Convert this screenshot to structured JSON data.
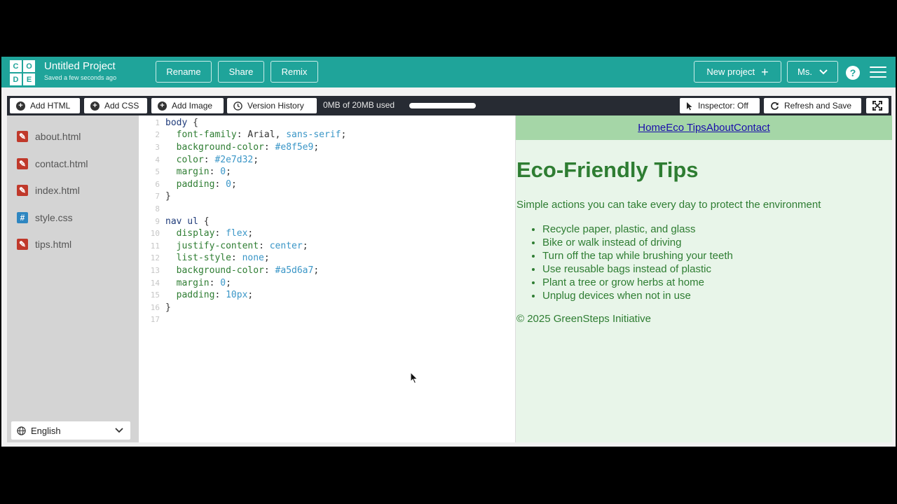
{
  "header": {
    "logo_letters": [
      "C",
      "O",
      "D",
      "E"
    ],
    "project_title": "Untitled Project",
    "saved_status": "Saved a few seconds ago",
    "rename_label": "Rename",
    "share_label": "Share",
    "remix_label": "Remix",
    "new_project_label": "New project",
    "user_label": "Ms.",
    "help_label": "?"
  },
  "toolbar": {
    "add_html_label": "Add HTML",
    "add_css_label": "Add CSS",
    "add_image_label": "Add Image",
    "version_history_label": "Version History",
    "usage_text": "0MB of 20MB used",
    "usage_fraction": 0.0,
    "inspector_label": "Inspector: Off",
    "refresh_label": "Refresh and Save"
  },
  "sidebar": {
    "files": [
      {
        "name": "about.html",
        "type": "html"
      },
      {
        "name": "contact.html",
        "type": "html"
      },
      {
        "name": "index.html",
        "type": "html"
      },
      {
        "name": "style.css",
        "type": "css"
      },
      {
        "name": "tips.html",
        "type": "html"
      }
    ],
    "language": "English"
  },
  "editor": {
    "lines": [
      {
        "n": "1",
        "parts": [
          [
            "sel",
            "body"
          ],
          [
            "plain",
            " {"
          ]
        ]
      },
      {
        "n": "2",
        "parts": [
          [
            "prop",
            "  font-family"
          ],
          [
            "plain",
            ": Arial, "
          ],
          [
            "val",
            "sans-serif"
          ],
          [
            "plain",
            ";"
          ]
        ]
      },
      {
        "n": "3",
        "parts": [
          [
            "prop",
            "  background-color"
          ],
          [
            "plain",
            ": "
          ],
          [
            "val",
            "#e8f5e9"
          ],
          [
            "plain",
            ";"
          ]
        ]
      },
      {
        "n": "4",
        "parts": [
          [
            "prop",
            "  color"
          ],
          [
            "plain",
            ": "
          ],
          [
            "val",
            "#2e7d32"
          ],
          [
            "plain",
            ";"
          ]
        ]
      },
      {
        "n": "5",
        "parts": [
          [
            "prop",
            "  margin"
          ],
          [
            "plain",
            ": "
          ],
          [
            "val",
            "0"
          ],
          [
            "plain",
            ";"
          ]
        ]
      },
      {
        "n": "6",
        "parts": [
          [
            "prop",
            "  padding"
          ],
          [
            "plain",
            ": "
          ],
          [
            "val",
            "0"
          ],
          [
            "plain",
            ";"
          ]
        ]
      },
      {
        "n": "7",
        "parts": [
          [
            "plain",
            "}"
          ]
        ]
      },
      {
        "n": "8",
        "parts": []
      },
      {
        "n": "9",
        "parts": [
          [
            "sel",
            "nav ul"
          ],
          [
            "plain",
            " {"
          ]
        ]
      },
      {
        "n": "10",
        "parts": [
          [
            "prop",
            "  display"
          ],
          [
            "plain",
            ": "
          ],
          [
            "val",
            "flex"
          ],
          [
            "plain",
            ";"
          ]
        ]
      },
      {
        "n": "11",
        "parts": [
          [
            "prop",
            "  justify-content"
          ],
          [
            "plain",
            ": "
          ],
          [
            "val",
            "center"
          ],
          [
            "plain",
            ";"
          ]
        ]
      },
      {
        "n": "12",
        "parts": [
          [
            "prop",
            "  list-style"
          ],
          [
            "plain",
            ": "
          ],
          [
            "val",
            "none"
          ],
          [
            "plain",
            ";"
          ]
        ]
      },
      {
        "n": "13",
        "parts": [
          [
            "prop",
            "  background-color"
          ],
          [
            "plain",
            ": "
          ],
          [
            "val",
            "#a5d6a7"
          ],
          [
            "plain",
            ";"
          ]
        ]
      },
      {
        "n": "14",
        "parts": [
          [
            "prop",
            "  margin"
          ],
          [
            "plain",
            ": "
          ],
          [
            "val",
            "0"
          ],
          [
            "plain",
            ";"
          ]
        ]
      },
      {
        "n": "15",
        "parts": [
          [
            "prop",
            "  padding"
          ],
          [
            "plain",
            ": "
          ],
          [
            "val",
            "10px"
          ],
          [
            "plain",
            ";"
          ]
        ]
      },
      {
        "n": "16",
        "parts": [
          [
            "plain",
            "}"
          ]
        ]
      },
      {
        "n": "17",
        "parts": []
      }
    ]
  },
  "preview": {
    "nav": [
      "Home",
      "Eco Tips",
      "About",
      "Contact"
    ],
    "heading": "Eco-Friendly Tips",
    "intro": "Simple actions you can take every day to protect the environment",
    "tips": [
      "Recycle paper, plastic, and glass",
      "Bike or walk instead of driving",
      "Turn off the tap while brushing your teeth",
      "Use reusable bags instead of plastic",
      "Plant a tree or grow herbs at home",
      "Unplug devices when not in use"
    ],
    "footer": "© 2025 GreenSteps Initiative"
  },
  "colors": {
    "brand": "#1fa49a",
    "toolbar_bg": "#272b33",
    "preview_bg": "#e8f5e9",
    "preview_nav_bg": "#a5d6a7",
    "preview_text": "#2e7d32"
  }
}
